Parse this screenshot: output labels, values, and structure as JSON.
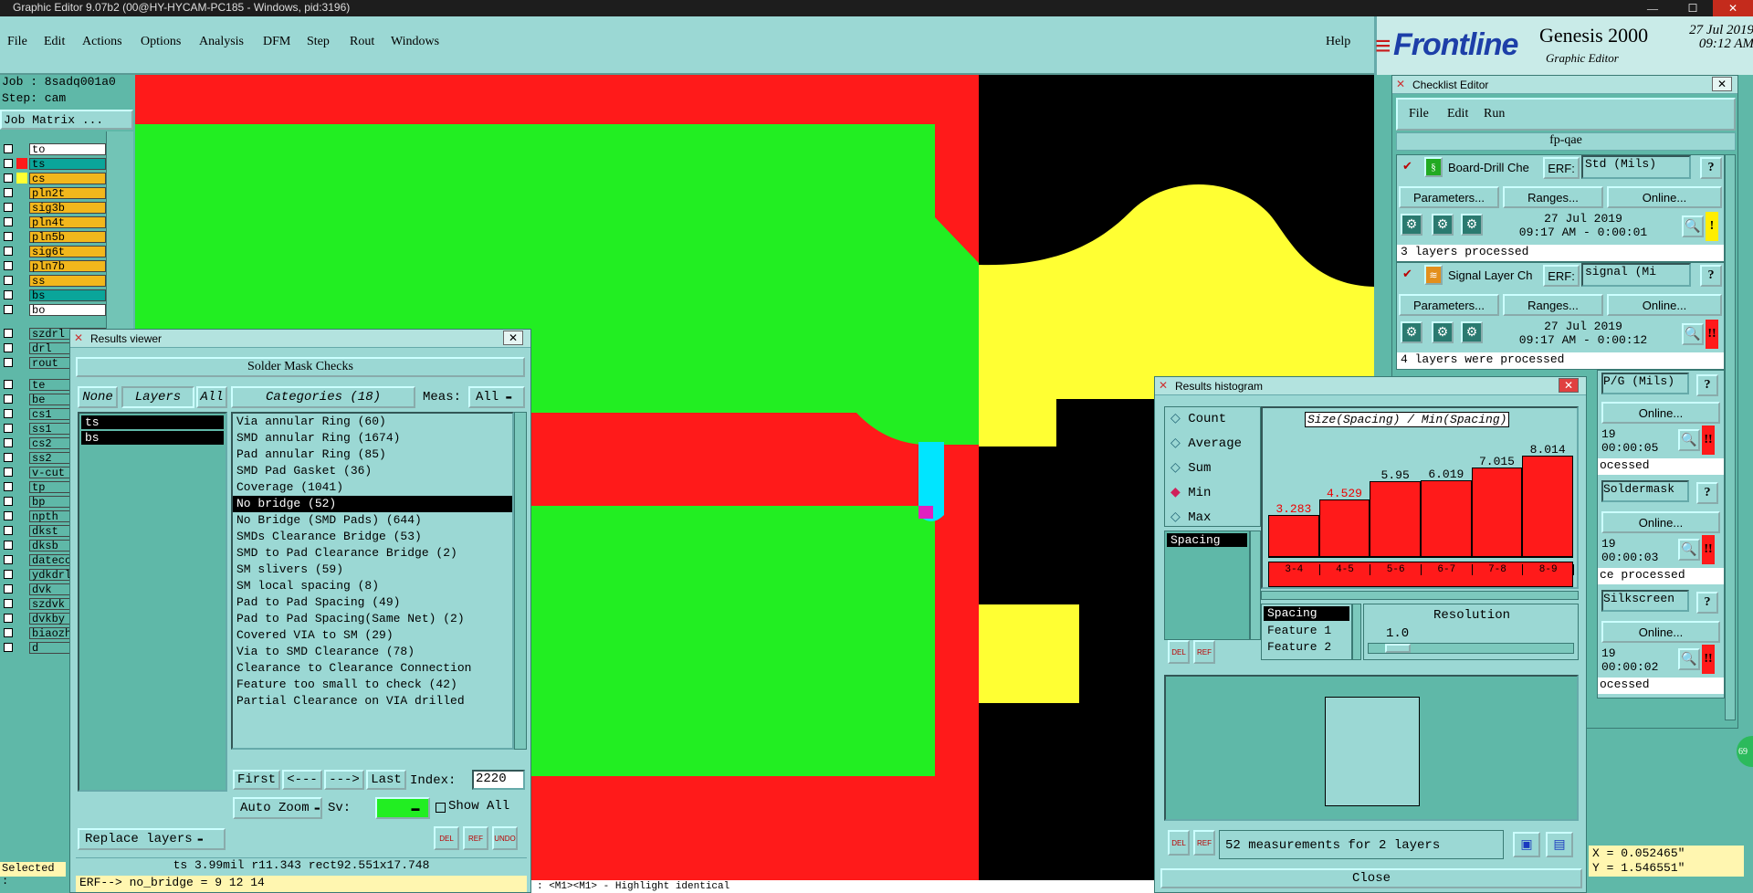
{
  "window": {
    "title": "Graphic Editor 9.07b2 (00@HY-HYCAM-PC185 - Windows, pid:3196)",
    "min": "—",
    "max": "☐",
    "close": "✕"
  },
  "menu": {
    "items": [
      "File",
      "Edit",
      "Actions",
      "Options",
      "Analysis",
      "DFM",
      "Step",
      "Rout",
      "Windows"
    ],
    "help": "Help"
  },
  "brand": {
    "logo": "Frontline",
    "product": "Genesis 2000",
    "subtitle": "Graphic Editor",
    "date": "27 Jul 2019",
    "time": "09:12 AM"
  },
  "job": {
    "job": "Job : 8sadq001a0",
    "step": "Step: cam",
    "matrix_button": "Job Matrix ..."
  },
  "layers": [
    {
      "name": "to",
      "color": "#ffffff"
    },
    {
      "name": "ts",
      "color": "#0aa59a"
    },
    {
      "name": "cs",
      "color": "#f2b71c"
    },
    {
      "name": "pln2t",
      "color": "#f2b71c"
    },
    {
      "name": "sig3b",
      "color": "#f2b71c"
    },
    {
      "name": "pln4t",
      "color": "#f2b71c"
    },
    {
      "name": "pln5b",
      "color": "#f2b71c"
    },
    {
      "name": "sig6t",
      "color": "#f2b71c"
    },
    {
      "name": "pln7b",
      "color": "#f2b71c"
    },
    {
      "name": "ss",
      "color": "#f2b71c"
    },
    {
      "name": "bs",
      "color": "#0aa59a"
    },
    {
      "name": "bo",
      "color": "#ffffff"
    },
    {
      "name": "szdrl",
      "color": "#5fb8a8"
    },
    {
      "name": "drl",
      "color": "#5fb8a8"
    },
    {
      "name": "rout",
      "color": "#5fb8a8"
    },
    {
      "name": "te",
      "color": "#5fb8a8"
    },
    {
      "name": "be",
      "color": "#5fb8a8"
    },
    {
      "name": "cs1",
      "color": "#5fb8a8"
    },
    {
      "name": "ss1",
      "color": "#5fb8a8"
    },
    {
      "name": "cs2",
      "color": "#5fb8a8"
    },
    {
      "name": "ss2",
      "color": "#5fb8a8"
    },
    {
      "name": "v-cut",
      "color": "#5fb8a8"
    },
    {
      "name": "tp",
      "color": "#5fb8a8"
    },
    {
      "name": "bp",
      "color": "#5fb8a8"
    },
    {
      "name": "npth",
      "color": "#5fb8a8"
    },
    {
      "name": "dkst",
      "color": "#5fb8a8"
    },
    {
      "name": "dksb",
      "color": "#5fb8a8"
    },
    {
      "name": "datecc",
      "color": "#5fb8a8"
    },
    {
      "name": "ydkdrl",
      "color": "#5fb8a8"
    },
    {
      "name": "dvk",
      "color": "#5fb8a8"
    },
    {
      "name": "szdvk",
      "color": "#5fb8a8"
    },
    {
      "name": "dvkby",
      "color": "#5fb8a8"
    },
    {
      "name": "biaozh",
      "color": "#5fb8a8"
    },
    {
      "name": "d",
      "color": "#5fb8a8"
    }
  ],
  "selected": "Selected :",
  "results_viewer": {
    "title": "Results viewer",
    "header": "Solder Mask Checks",
    "none": "None",
    "layers": "Layers",
    "all": "All",
    "categories_label": "Categories (18)",
    "meas_label": "Meas:",
    "meas_value": "All",
    "layer_list": [
      "ts",
      "bs"
    ],
    "categories": [
      "Via annular Ring (60)",
      "SMD annular Ring (1674)",
      "Pad annular Ring (85)",
      "SMD Pad Gasket (36)",
      "Coverage (1041)",
      "No bridge (52)",
      "No Bridge (SMD Pads) (644)",
      "SMDs Clearance Bridge (53)",
      "SMD to Pad Clearance Bridge (2)",
      "SM slivers (59)",
      "SM local spacing (8)",
      "Pad to Pad Spacing (49)",
      "Pad to Pad Spacing(Same Net) (2)",
      "Covered VIA to SM (29)",
      "Via to SMD Clearance (78)",
      "Clearance to Clearance Connection",
      "Feature too small to check (42)",
      "Partial Clearance on VIA drilled"
    ],
    "selected_category": "No bridge (52)",
    "first": "First",
    "prev": "<---",
    "next": "--->",
    "last": "Last",
    "index_label": "Index:",
    "index_value": "2220",
    "autozoom": "Auto Zoom",
    "sv": "Sv:",
    "show_all": "Show All",
    "replace": "Replace layers",
    "del": "DEL",
    "ref": "REF",
    "und": "UNDO",
    "status": "ts 3.99mil   r11.343   rect92.551x17.748",
    "erf": "ERF--> no_bridge = 9 12 14"
  },
  "checklist": {
    "title": "Checklist Editor",
    "menu": [
      "File",
      "Edit",
      "Run"
    ],
    "name": "fp-qae",
    "items": [
      {
        "name": "Board-Drill Che",
        "erf": "Std (Mils)",
        "date": "27 Jul 2019",
        "time": "09:17 AM - 0:00:01",
        "msg": "3 layers processed",
        "flag": "!",
        "flag_color": "#ffee00"
      },
      {
        "name": "Signal Layer Ch",
        "erf": "signal (Mi",
        "date": "27 Jul 2019",
        "time": "09:17 AM - 0:00:12",
        "msg": "4 layers were processed",
        "flag": "!!",
        "flag_color": "#ff1a1a"
      }
    ],
    "params": "Parameters...",
    "ranges": "Ranges...",
    "online": "Online...",
    "erf_label": "ERF:",
    "partial": [
      "P/G (Mils)",
      "Online...",
      "19",
      "00:00:05",
      "ocessed",
      "Soldermask",
      "Online...",
      "19",
      "00:00:03",
      "ce processed",
      "Silkscreen",
      "Online...",
      "19",
      "00:00:02",
      "ocessed"
    ]
  },
  "histogram": {
    "title": "Results histogram",
    "options": [
      "Count",
      "Average",
      "Sum",
      "Min",
      "Max"
    ],
    "selected_option": "Min",
    "list": [
      "Spacing"
    ],
    "chart_title": "Size(Spacing) / Min(Spacing)",
    "resolution_label": "Resolution",
    "resolution_value": "1.0",
    "fields": [
      "Spacing",
      "Feature 1",
      "Feature 2"
    ],
    "summary": "52 measurements for 2 layers",
    "close": "Close",
    "del": "DEL",
    "ref": "REF"
  },
  "chart_data": {
    "type": "bar",
    "title": "Size(Spacing) / Min(Spacing)",
    "categories": [
      "3-4",
      "4-5",
      "5-6",
      "6-7",
      "7-8",
      "8-9"
    ],
    "values": [
      3.283,
      4.529,
      5.95,
      6.019,
      7.015,
      8.014
    ],
    "value_labels": [
      "3.283",
      "4.529",
      "5.95",
      "6.019",
      "7.015",
      "8.014"
    ],
    "ylim": [
      0,
      9
    ],
    "grid": false,
    "color": "#ff1a1a"
  },
  "coords": {
    "x": "X = 0.052465\"",
    "y": "Y = 1.546551\""
  },
  "bottom_hint": ": <M1><M1> - Highlight identical",
  "badge": "69"
}
